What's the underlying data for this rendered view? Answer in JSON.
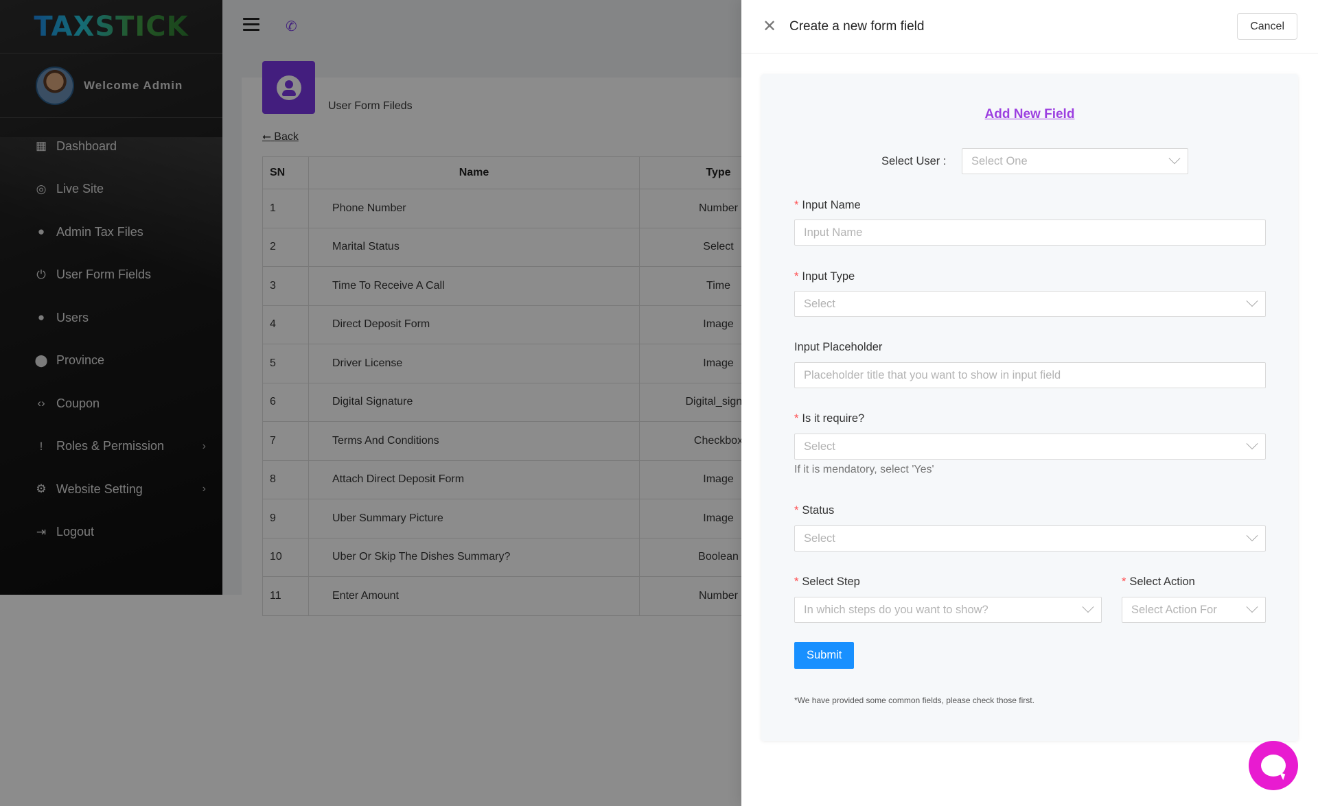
{
  "brand": {
    "logo": "TAXSTICK"
  },
  "sidebar": {
    "welcome": "Welcome Admin",
    "items": [
      {
        "label": "Dashboard",
        "icon": "dashboard-icon",
        "glyph": "▦"
      },
      {
        "label": "Live Site",
        "icon": "live-site-icon",
        "glyph": "◎"
      },
      {
        "label": "Admin Tax Files",
        "icon": "account-icon",
        "glyph": "●"
      },
      {
        "label": "User Form Fields",
        "icon": "power-icon",
        "glyph": "⏻"
      },
      {
        "label": "Users",
        "icon": "account-icon",
        "glyph": "●"
      },
      {
        "label": "Province",
        "icon": "location-pin-icon",
        "glyph": "⬤"
      },
      {
        "label": "Coupon",
        "icon": "code-icon",
        "glyph": "‹›"
      },
      {
        "label": "Roles & Permission",
        "icon": "feedback-icon",
        "glyph": "!",
        "chevron": "›"
      },
      {
        "label": "Website Setting",
        "icon": "gear-icon",
        "glyph": "⚙",
        "chevron": "›"
      },
      {
        "label": "Logout",
        "icon": "logout-icon",
        "glyph": "⇥"
      }
    ]
  },
  "topbar": {
    "menu_icon": "hamburger-icon",
    "phone_icon": "phone-icon",
    "phone_glyph": "✆"
  },
  "page": {
    "heading": "User Form Fileds",
    "back": "Back",
    "back_arrow": "⭠"
  },
  "table": {
    "headers": [
      "SN",
      "Name",
      "Type"
    ],
    "rows": [
      {
        "sn": "1",
        "name": "Phone Number",
        "type": "Number"
      },
      {
        "sn": "2",
        "name": "Marital Status",
        "type": "Select"
      },
      {
        "sn": "3",
        "name": "Time To Receive A Call",
        "type": "Time"
      },
      {
        "sn": "4",
        "name": "Direct Deposit Form",
        "type": "Image"
      },
      {
        "sn": "5",
        "name": "Driver License",
        "type": "Image"
      },
      {
        "sn": "6",
        "name": "Digital Signature",
        "type": "Digital_signat"
      },
      {
        "sn": "7",
        "name": "Terms And Conditions",
        "type": "Checkbox"
      },
      {
        "sn": "8",
        "name": "Attach Direct Deposit Form",
        "type": "Image"
      },
      {
        "sn": "9",
        "name": "Uber Summary Picture",
        "type": "Image"
      },
      {
        "sn": "10",
        "name": "Uber Or Skip The Dishes Summary?",
        "type": "Boolean"
      },
      {
        "sn": "11",
        "name": "Enter Amount",
        "type": "Number"
      }
    ]
  },
  "drawer": {
    "close_glyph": "✕",
    "title": "Create a new form field",
    "cancel": "Cancel",
    "form": {
      "title": "Add New Field",
      "select_user": {
        "label": "Select User :",
        "placeholder": "Select One"
      },
      "input_name": {
        "label": "Input Name",
        "placeholder": "Input Name"
      },
      "input_type": {
        "label": "Input Type",
        "placeholder": "Select"
      },
      "input_placeholder": {
        "label": "Input Placeholder",
        "placeholder": "Placeholder title that you want to show in input field"
      },
      "is_required": {
        "label": "Is it require?",
        "placeholder": "Select",
        "hint": "If it is mendatory, select 'Yes'"
      },
      "status": {
        "label": "Status",
        "placeholder": "Select"
      },
      "select_step": {
        "label": "Select Step",
        "placeholder": "In which steps do you want to show?"
      },
      "select_action": {
        "label": "Select Action",
        "placeholder": "Select Action For"
      },
      "required_mark": "*",
      "submit": "Submit",
      "note": "*We have provided some common fields, please check those first."
    }
  },
  "colors": {
    "accent": "#7a38e6",
    "link": "#9c3fe0",
    "primary_button": "#1890ff",
    "required": "#ff4d4f",
    "chat": "#e81bd0"
  }
}
